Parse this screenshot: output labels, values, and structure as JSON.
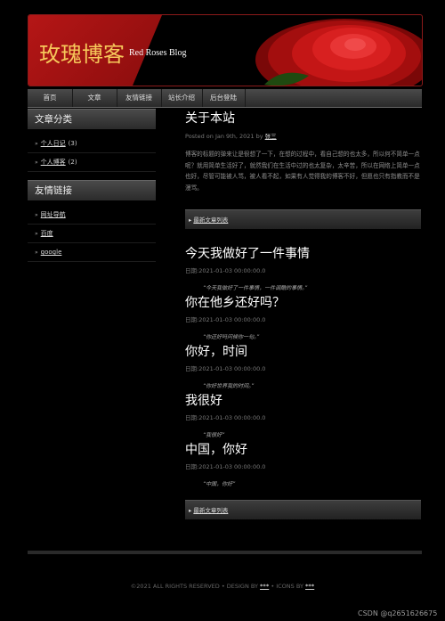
{
  "header": {
    "title": "玫瑰博客",
    "subtitle": "Red Roses Blog"
  },
  "nav": [
    "首页",
    "文章",
    "友情链接",
    "站长介绍",
    "后台登陆"
  ],
  "sidebar": {
    "categories_title": "文章分类",
    "categories": [
      {
        "label": "个人日记",
        "count": "(3)"
      },
      {
        "label": "个人博客",
        "count": "(2)"
      }
    ],
    "links_title": "友情链接",
    "links": [
      "网址导航",
      "百度",
      "google"
    ]
  },
  "main": {
    "about_title": "关于本站",
    "about_meta_prefix": "Posted on Jan 9th, 2021 by",
    "about_author": "张三",
    "about_body": "博客的标题的弹来让是很想了一下，在想的过程中，看自己想的也太多，所以何不简单一点呢？就用简单生活好了，就然我们在生活中过的也太复杂，太辛苦，所以在网络上简单一点也好，尽管可能被人骂，被人看不起，如果有人觉得我的博客不好，但愿也只有指教而不是漫骂。",
    "more_label": "最新文章列表",
    "posts": [
      {
        "title": "今天我做好了一件事情",
        "date": "日期:2021-01-03 00:00:00.0",
        "quote": "“今天我做好了一件事情，一件调酷的事情。”"
      },
      {
        "title": "你在他乡还好吗？",
        "date": "日期:2021-01-03 00:00:00.0",
        "quote": "“你还好吗问候你一句。”"
      },
      {
        "title": "你好，时间",
        "date": "日期:2021-01-03 00:00:00.0",
        "quote": "“你好世界我的时间。”"
      },
      {
        "title": "我很好",
        "date": "日期:2021-01-03 00:00:00.0",
        "quote": "“我很好”"
      },
      {
        "title": "中国，你好",
        "date": "日期:2021-01-03 00:00:00.0",
        "quote": "“中国，你好”"
      }
    ],
    "more_label_2": "最新文章列表"
  },
  "footer": {
    "copyright": "©2021 ALL RIGHTS RESERVED",
    "design_by": "DESIGN BY",
    "design_name": "***",
    "icons_by": "ICONS BY",
    "icons_name": "***"
  },
  "watermark": "CSDN @q2651626675"
}
